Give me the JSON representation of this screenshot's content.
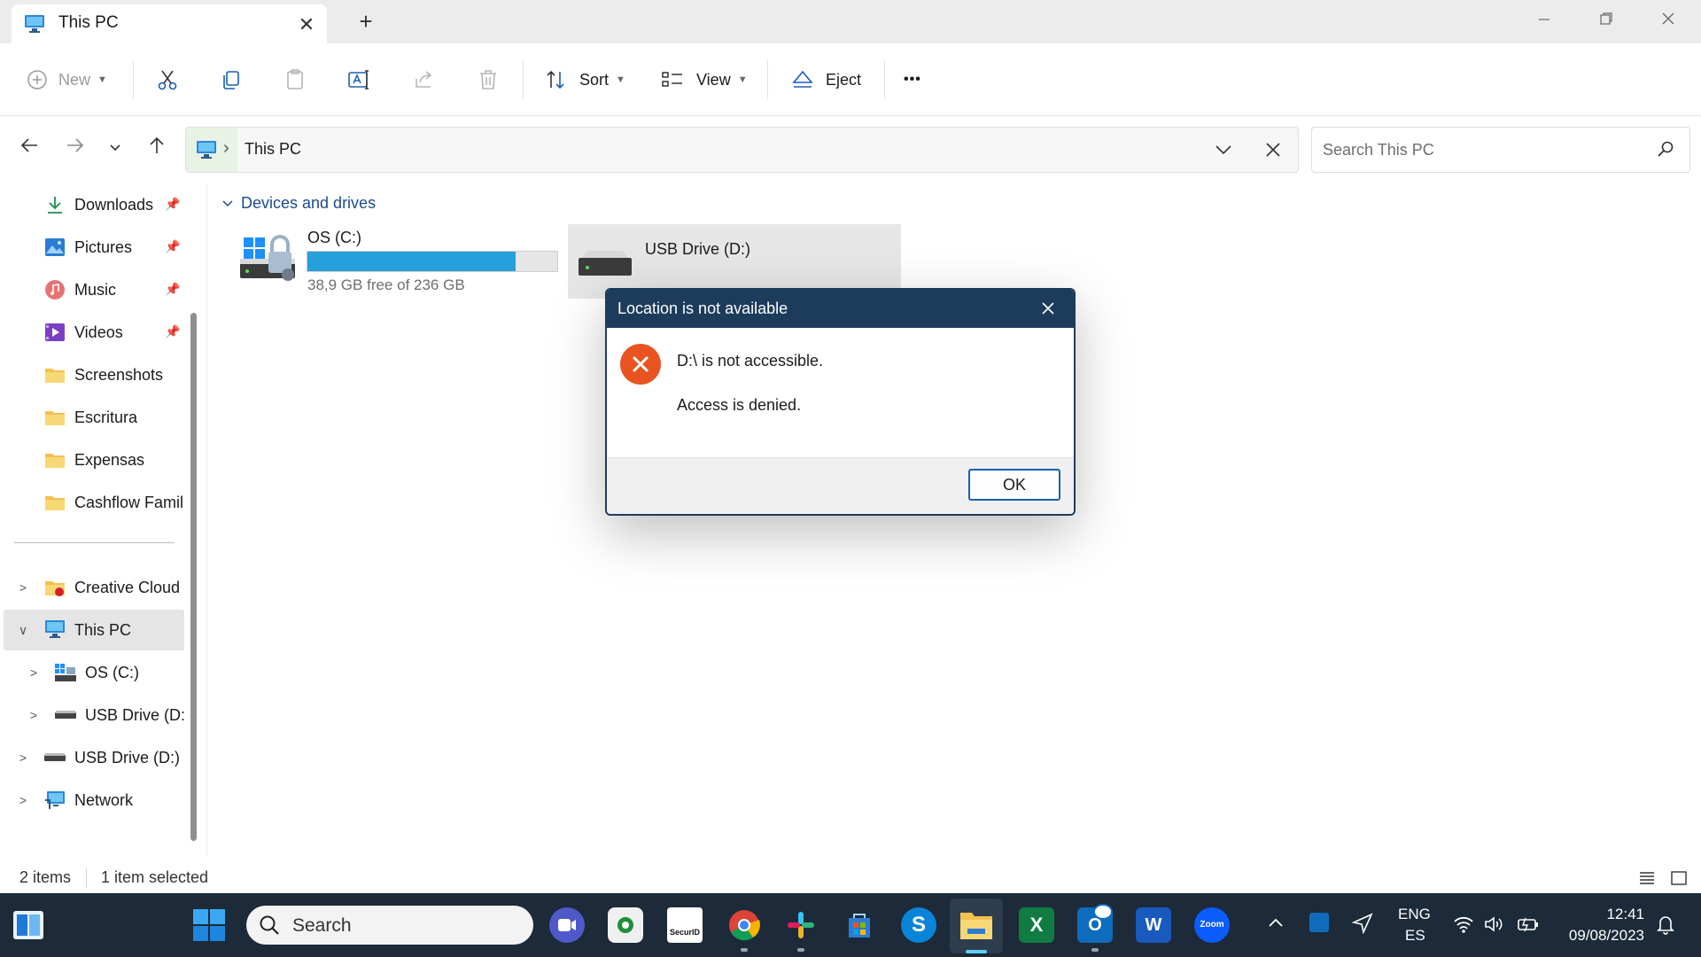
{
  "window": {
    "tab_title": "This PC",
    "tab_close": "✕",
    "new_tab": "+"
  },
  "toolbar": {
    "new": "New",
    "sort": "Sort",
    "view": "View",
    "eject": "Eject",
    "more": "•••"
  },
  "address": {
    "separator": "›",
    "path": "This PC",
    "search_placeholder": "Search This PC"
  },
  "sidebar": {
    "quick": [
      {
        "label": "Downloads",
        "icon": "download-icon"
      },
      {
        "label": "Pictures",
        "icon": "pictures-icon"
      },
      {
        "label": "Music",
        "icon": "music-icon"
      },
      {
        "label": "Videos",
        "icon": "videos-icon"
      },
      {
        "label": "Screenshots",
        "icon": "folder-icon"
      },
      {
        "label": "Escritura",
        "icon": "folder-icon"
      },
      {
        "label": "Expensas",
        "icon": "folder-icon"
      },
      {
        "label": "Cashflow Familia",
        "icon": "folder-icon"
      }
    ],
    "tree": [
      {
        "label": "Creative Cloud F",
        "icon": "creative-cloud-folder-icon"
      },
      {
        "label": "This PC",
        "icon": "computer-icon",
        "selected": true
      },
      {
        "label": "OS (C:)",
        "icon": "os-drive-icon"
      },
      {
        "label": "USB Drive (D:)",
        "icon": "usb-drive-icon"
      },
      {
        "label": "USB Drive (D:)",
        "icon": "usb-drive-icon"
      },
      {
        "label": "Network",
        "icon": "network-icon"
      }
    ]
  },
  "content": {
    "group": "Devices and drives",
    "drives": [
      {
        "name": "OS (C:)",
        "space": "38,9 GB free of 236 GB",
        "used_fraction": 0.835
      },
      {
        "name": "USB Drive (D:)"
      }
    ]
  },
  "dialog": {
    "title": "Location is not available",
    "message": "D:\\ is not accessible.",
    "detail": "Access is denied.",
    "ok": "OK"
  },
  "status": {
    "items": "2 items",
    "selected": "1 item selected"
  },
  "taskbar": {
    "search": "Search",
    "apps": [
      "SecurID",
      "Zoom"
    ],
    "lang": "ENG",
    "layout": "ES",
    "time": "12:41",
    "date": "09/08/2023"
  },
  "colors": {
    "accent": "#26a0da",
    "dialog_title": "#1d3c5c",
    "error": "#e8531f",
    "taskbar": "#1c2a39"
  }
}
